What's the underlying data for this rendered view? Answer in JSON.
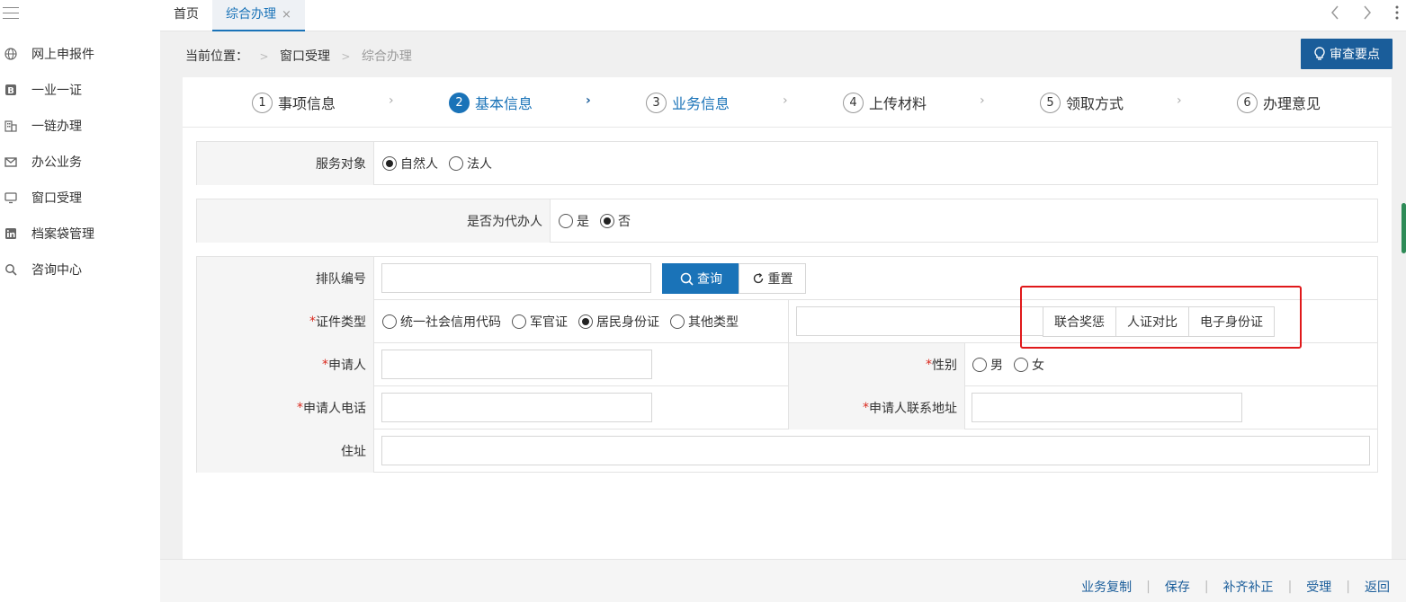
{
  "sidebar": {
    "items": [
      {
        "label": "网上申报件",
        "icon": "globe-icon"
      },
      {
        "label": "一业一证",
        "icon": "b-badge-icon"
      },
      {
        "label": "一链办理",
        "icon": "building-icon"
      },
      {
        "label": "办公业务",
        "icon": "mail-icon"
      },
      {
        "label": "窗口受理",
        "icon": "monitor-icon"
      },
      {
        "label": "档案袋管理",
        "icon": "linkedin-icon"
      },
      {
        "label": "咨询中心",
        "icon": "search-icon"
      }
    ]
  },
  "tabs": {
    "home": "首页",
    "active": "综合办理",
    "close": "×"
  },
  "breadcrumb": {
    "prefix": "当前位置：",
    "sep": ">",
    "level1": "窗口受理",
    "current": "综合办理"
  },
  "tips_button": "审查要点",
  "steps": [
    {
      "num": "1",
      "label": "事项信息"
    },
    {
      "num": "2",
      "label": "基本信息"
    },
    {
      "num": "3",
      "label": "业务信息"
    },
    {
      "num": "4",
      "label": "上传材料"
    },
    {
      "num": "5",
      "label": "领取方式"
    },
    {
      "num": "6",
      "label": "办理意见"
    }
  ],
  "chevron": "›",
  "form": {
    "service_target": {
      "label": "服务对象",
      "options": [
        "自然人",
        "法人"
      ],
      "selected": "自然人"
    },
    "agent": {
      "label": "是否为代办人",
      "options": [
        "是",
        "否"
      ],
      "selected": "否"
    },
    "queue_no": {
      "label": "排队编号",
      "value": "",
      "query_btn": "查询",
      "reset_btn": "重置"
    },
    "id_type": {
      "req": "*",
      "label": "证件类型",
      "options": [
        "统一社会信用代码",
        "军官证",
        "居民身份证",
        "其他类型"
      ],
      "selected": "居民身份证",
      "value": ""
    },
    "id_buttons": [
      "联合奖惩",
      "人证对比",
      "电子身份证"
    ],
    "applicant": {
      "req": "*",
      "label": "申请人",
      "value": ""
    },
    "gender": {
      "req": "*",
      "label": "性别",
      "options": [
        "男",
        "女"
      ]
    },
    "phone": {
      "req": "*",
      "label": "申请人电话",
      "value": ""
    },
    "contact_address": {
      "req": "*",
      "label": "申请人联系地址",
      "value": ""
    },
    "address": {
      "label": "住址",
      "value": ""
    }
  },
  "bottom_actions": [
    "业务复制",
    "保存",
    "补齐补正",
    "受理",
    "返回"
  ],
  "colors": {
    "primary": "#1a73b8",
    "dark_primary": "#1a5d9a",
    "highlight": "#e0191b"
  }
}
